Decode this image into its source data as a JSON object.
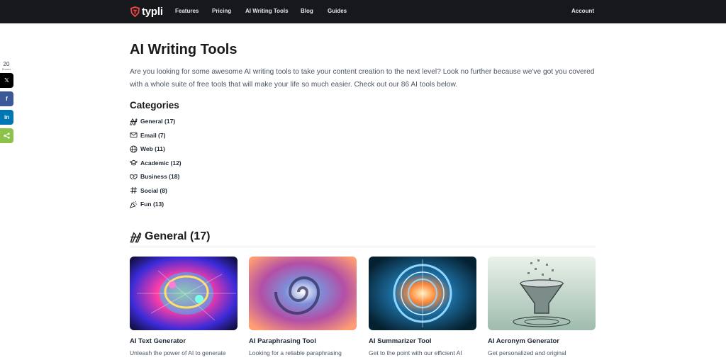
{
  "nav": {
    "logo_text": "typli",
    "items": [
      "Features",
      "Pricing",
      "AI Writing Tools",
      "Blog",
      "Guides"
    ],
    "account": "Account"
  },
  "share": {
    "count": "20",
    "label": "Shares",
    "buttons": [
      {
        "icon": "x-icon",
        "glyph": "𝕏",
        "color": "#000000"
      },
      {
        "icon": "facebook-icon",
        "glyph": "f",
        "color": "#3b5998"
      },
      {
        "icon": "linkedin-icon",
        "glyph": "in",
        "color": "#0077b5"
      },
      {
        "icon": "share-icon",
        "glyph": "<",
        "color": "#8bc34a"
      }
    ]
  },
  "page": {
    "title": "AI Writing Tools",
    "intro": "Are you looking for some awesome AI writing tools to take your content creation to the next level? Look no further because we've got you covered with a whole suite of free tools that will make your life so much easier. Check out our 86 AI tools below."
  },
  "categories": {
    "heading": "Categories",
    "items": [
      {
        "label": "General (17)",
        "icon": "pen-ruler-icon"
      },
      {
        "label": "Email (7)",
        "icon": "envelope-icon"
      },
      {
        "label": "Web (11)",
        "icon": "globe-icon"
      },
      {
        "label": "Academic (12)",
        "icon": "graduation-cap-icon"
      },
      {
        "label": "Business (18)",
        "icon": "handshake-icon"
      },
      {
        "label": "Social (8)",
        "icon": "hashtag-icon"
      },
      {
        "label": "Fun (13)",
        "icon": "party-popper-icon"
      }
    ]
  },
  "section": {
    "title": "General (17)",
    "icon": "pen-ruler-icon"
  },
  "cards": [
    {
      "title": "AI Text Generator",
      "desc": "Unleash the power of AI to generate",
      "image": "neon-brain-image"
    },
    {
      "title": "AI Paraphrasing Tool",
      "desc": "Looking for a reliable paraphrasing",
      "image": "spiral-vortex-image"
    },
    {
      "title": "AI Summarizer Tool",
      "desc": "Get to the point with our efficient AI",
      "image": "glowing-portal-image"
    },
    {
      "title": "AI Acronym Generator",
      "desc": "Get personalized and original",
      "image": "letter-funnel-image"
    }
  ],
  "colors": {
    "topbar": "#17181c",
    "brand": "#ef4444"
  }
}
